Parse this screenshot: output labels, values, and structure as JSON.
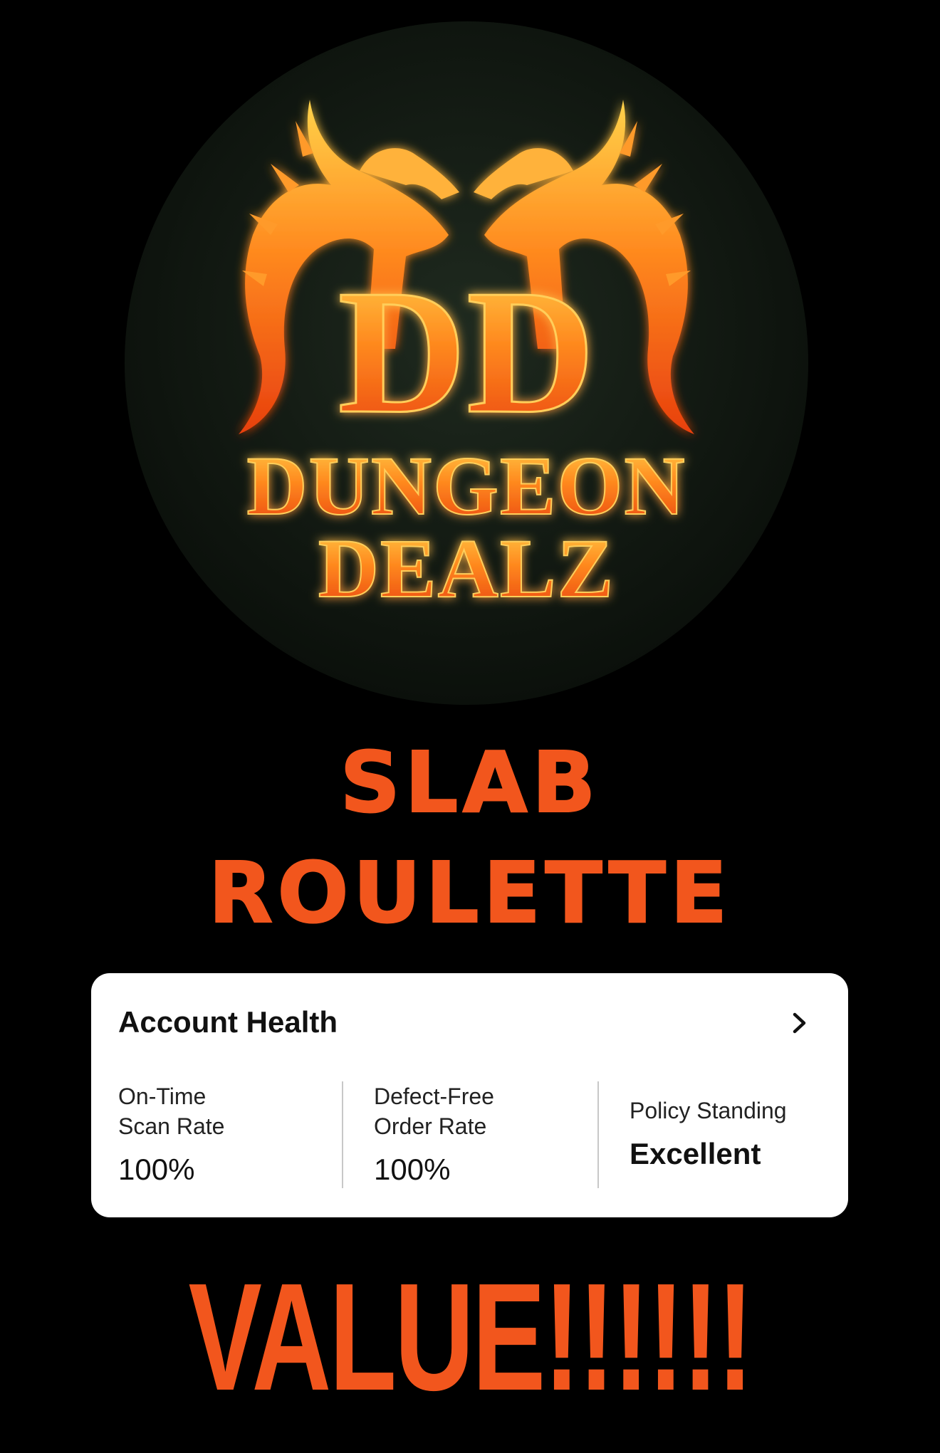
{
  "logo": {
    "monogram": "DD",
    "line1": "DUNGEON",
    "line2": "DEALZ",
    "fire_color": "#ff7a1a",
    "glow_color": "#ff3d00",
    "disc_color": "#141b14"
  },
  "headline": {
    "line1": "SLAB",
    "line2": "ROULETTE",
    "color": "#f2561d"
  },
  "account_health": {
    "title": "Account Health",
    "chevron_icon": "chevron-right-icon",
    "metrics": [
      {
        "label": "On-Time\nScan Rate",
        "value": "100%"
      },
      {
        "label": "Defect-Free\nOrder Rate",
        "value": "100%"
      },
      {
        "label": "Policy Standing",
        "value": "Excellent"
      }
    ]
  },
  "footer": {
    "text": "VALUE!!!!!!",
    "color": "#f2561d"
  }
}
